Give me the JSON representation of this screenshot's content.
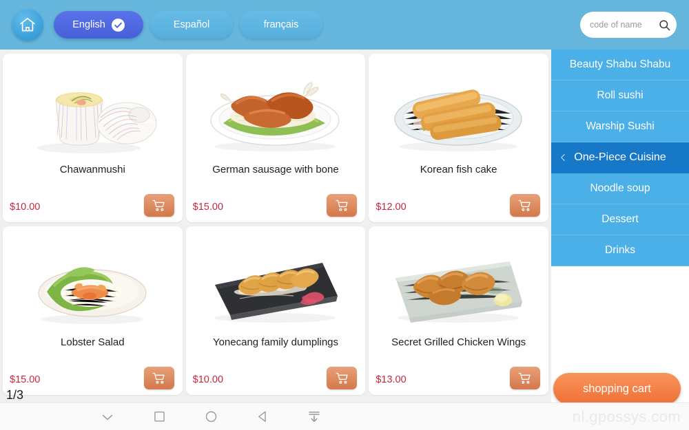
{
  "header": {
    "home_icon": "home-icon",
    "languages": [
      {
        "label": "English",
        "active": true,
        "check_icon": "check-circle-icon"
      },
      {
        "label": "Español",
        "active": false
      },
      {
        "label": "français",
        "active": false
      }
    ],
    "search": {
      "placeholder": "code of name",
      "value": "",
      "icon": "search-icon"
    }
  },
  "products": [
    {
      "name": "Chawanmushi",
      "price": "$10.00",
      "cart_icon": "shopping-cart-icon",
      "image": "steamed-egg-custard-bowl"
    },
    {
      "name": "German sausage with bone",
      "price": "$15.00",
      "cart_icon": "shopping-cart-icon",
      "image": "sausage-plate"
    },
    {
      "name": "Korean fish cake",
      "price": "$12.00",
      "cart_icon": "shopping-cart-icon",
      "image": "fried-fish-cake-plate"
    },
    {
      "name": "Lobster Salad",
      "price": "$15.00",
      "cart_icon": "shopping-cart-icon",
      "image": "lobster-salad-bowl"
    },
    {
      "name": "Yonecang family dumplings",
      "price": "$10.00",
      "cart_icon": "shopping-cart-icon",
      "image": "dumplings-slate-plate"
    },
    {
      "name": "Secret Grilled Chicken Wings",
      "price": "$13.00",
      "cart_icon": "shopping-cart-icon",
      "image": "grilled-chicken-wings-plate"
    }
  ],
  "pagination": {
    "label": "1/3"
  },
  "sidebar": {
    "items": [
      {
        "label": "Beauty Shabu Shabu",
        "selected": false
      },
      {
        "label": "Roll sushi",
        "selected": false
      },
      {
        "label": "Warship Sushi",
        "selected": false
      },
      {
        "label": "One-Piece Cuisine",
        "selected": true,
        "icon": "chevron-left-icon"
      },
      {
        "label": "Noodle soup",
        "selected": false
      },
      {
        "label": "Dessert",
        "selected": false
      },
      {
        "label": "Drinks",
        "selected": false
      }
    ],
    "cart_button": {
      "label": "shopping cart"
    }
  },
  "bottom_nav": {
    "items": [
      {
        "icon": "chevron-down-icon"
      },
      {
        "icon": "square-icon"
      },
      {
        "icon": "circle-icon"
      },
      {
        "icon": "back-triangle-icon"
      },
      {
        "icon": "download-icon"
      }
    ]
  },
  "watermark": {
    "text": "nl.gpossys.com"
  },
  "colors": {
    "header_bg": "#65b5dc",
    "sidebar_bg": "#4bb0e8",
    "sidebar_selected": "#1878c8",
    "accent_orange": "#ef6f35",
    "price_red": "#c9253c",
    "active_lang": "#4760da",
    "page_bg": "#f0f0f0"
  }
}
